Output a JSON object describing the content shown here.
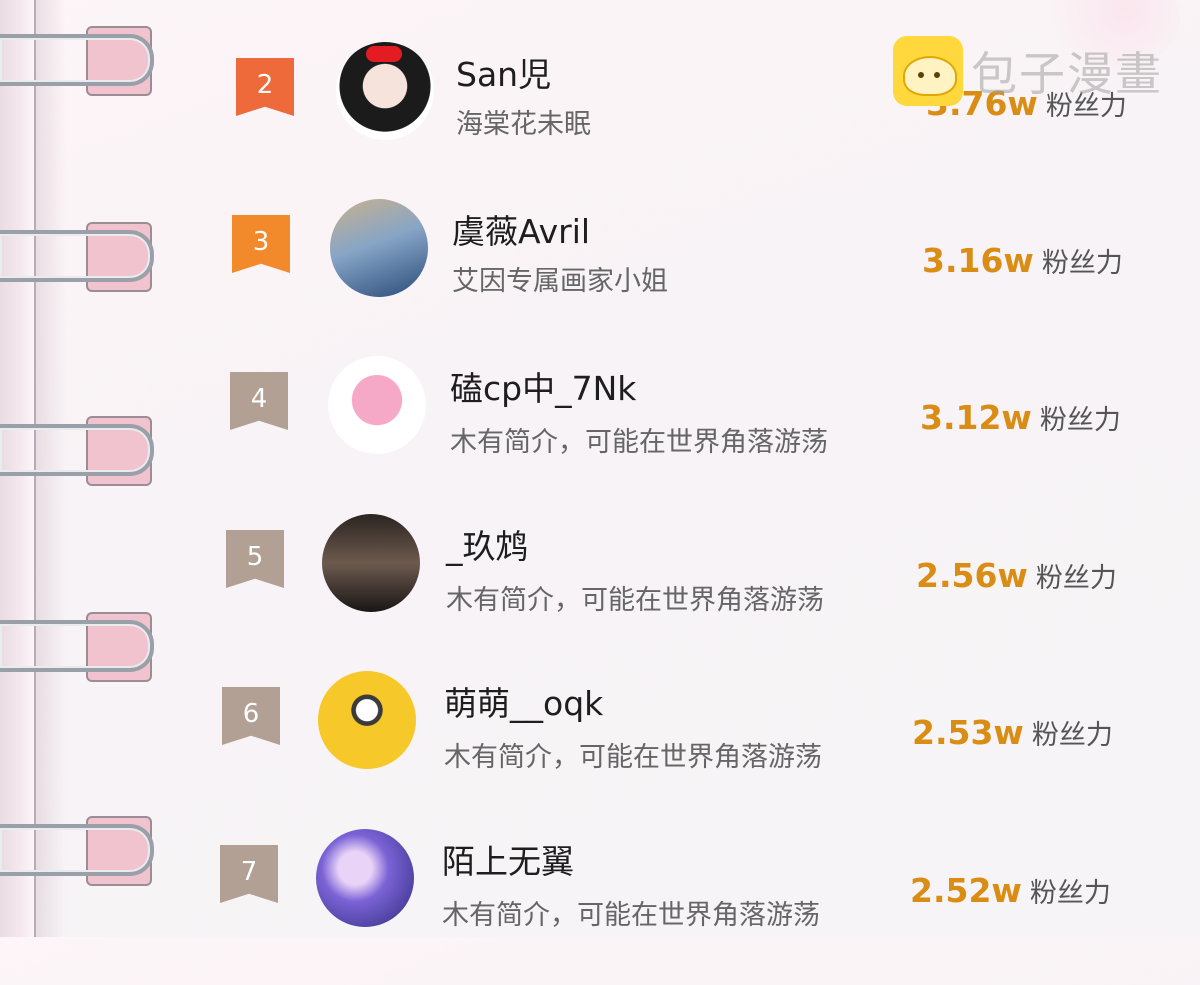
{
  "watermark": {
    "text": "包子漫畫",
    "icon": "bun-icon"
  },
  "rankings": [
    {
      "rank": "2",
      "badge_style": "top2",
      "name": "San児",
      "bio": "海棠花未眠",
      "fans_value": "3.76w",
      "fans_label": "粉丝力"
    },
    {
      "rank": "3",
      "badge_style": "top3",
      "name": "虞薇Avril",
      "bio": "艾因专属画家小姐",
      "fans_value": "3.16w",
      "fans_label": "粉丝力"
    },
    {
      "rank": "4",
      "badge_style": "normal",
      "name": "磕cp中_7Nk",
      "bio": "木有简介，可能在世界角落游荡",
      "fans_value": "3.12w",
      "fans_label": "粉丝力"
    },
    {
      "rank": "5",
      "badge_style": "normal",
      "name": "_玖鸩",
      "bio": "木有简介，可能在世界角落游荡",
      "fans_value": "2.56w",
      "fans_label": "粉丝力"
    },
    {
      "rank": "6",
      "badge_style": "normal",
      "name": "萌萌__oqk",
      "bio": "木有简介，可能在世界角落游荡",
      "fans_value": "2.53w",
      "fans_label": "粉丝力"
    },
    {
      "rank": "7",
      "badge_style": "normal",
      "name": "陌上无翼",
      "bio": "木有简介，可能在世界角落游荡",
      "fans_value": "2.52w",
      "fans_label": "粉丝力"
    }
  ],
  "colors": {
    "badge_top2": "#ee6a3a",
    "badge_top3": "#f28a2c",
    "badge_normal": "#b2a094",
    "fans_value": "#d98d15"
  }
}
